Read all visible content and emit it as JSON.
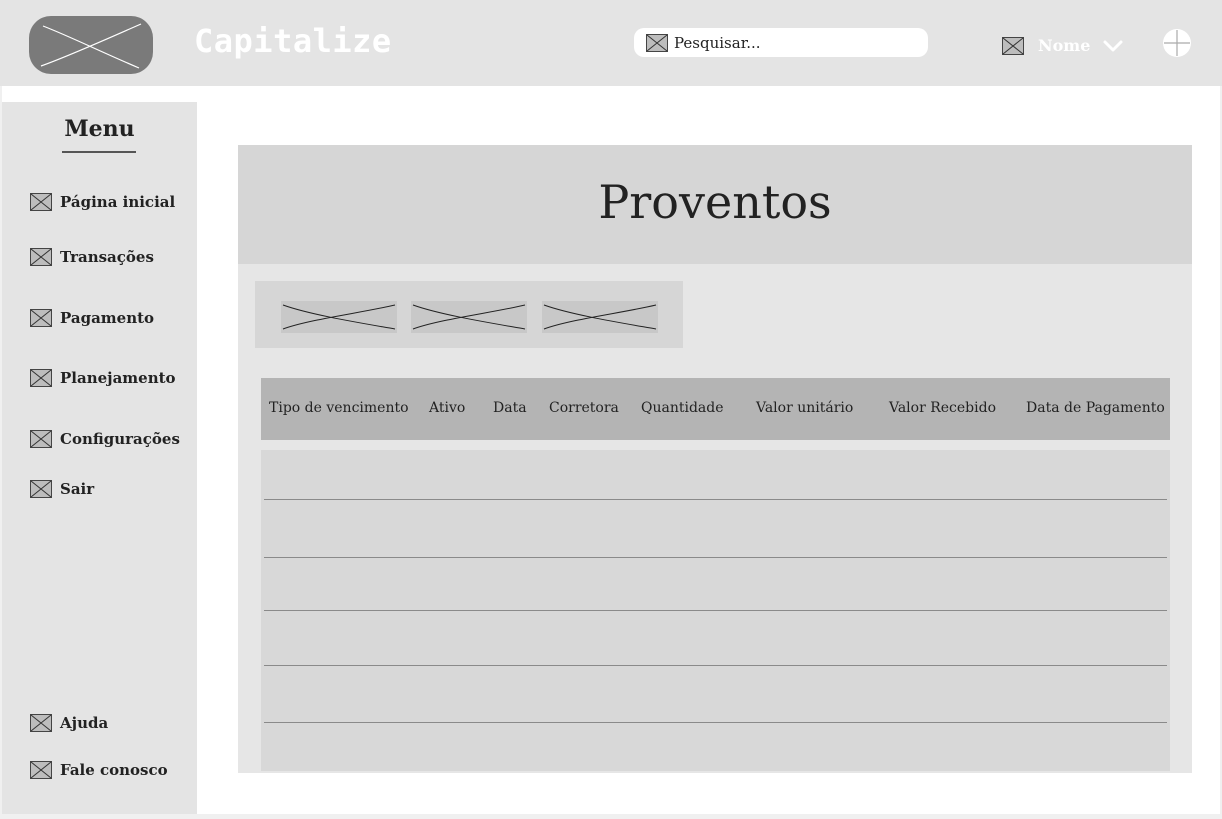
{
  "header": {
    "app_title": "Capitalize",
    "logo_icon": "image-placeholder-icon",
    "search": {
      "placeholder": "Pesquisar...",
      "icon": "image-placeholder-icon"
    },
    "user": {
      "name": "Nome",
      "avatar_icon": "image-placeholder-icon",
      "dropdown_icon": "chevron-down-icon"
    },
    "add_icon": "plus-circle-icon"
  },
  "sidebar": {
    "title": "Menu",
    "items": [
      {
        "label": "Página inicial",
        "icon": "image-placeholder-icon"
      },
      {
        "label": "Transações",
        "icon": "image-placeholder-icon"
      },
      {
        "label": "Pagamento",
        "icon": "image-placeholder-icon"
      },
      {
        "label": "Planejamento",
        "icon": "image-placeholder-icon"
      },
      {
        "label": "Configurações",
        "icon": "image-placeholder-icon"
      },
      {
        "label": "Sair",
        "icon": "image-placeholder-icon"
      }
    ],
    "footer_items": [
      {
        "label": "Ajuda",
        "icon": "image-placeholder-icon"
      },
      {
        "label": "Fale conosco",
        "icon": "image-placeholder-icon"
      }
    ]
  },
  "main": {
    "page_title": "Proventos",
    "toolbar_buttons": [
      "button-placeholder",
      "button-placeholder",
      "button-placeholder"
    ],
    "table": {
      "columns": [
        "Tipo de vencimento",
        "Ativo",
        "Data",
        "Corretora",
        "Quantidade",
        "Valor unitário",
        "Valor Recebido",
        "Data de Pagamento"
      ],
      "rows": []
    }
  },
  "colors": {
    "header_bg": "#e4e4e4",
    "sidebar_bg": "#e4e4e4",
    "card_bg": "#e6e6e6",
    "title_band": "#d6d6d6",
    "table_header": "#b4b4b4",
    "table_body": "#d8d8d8"
  }
}
